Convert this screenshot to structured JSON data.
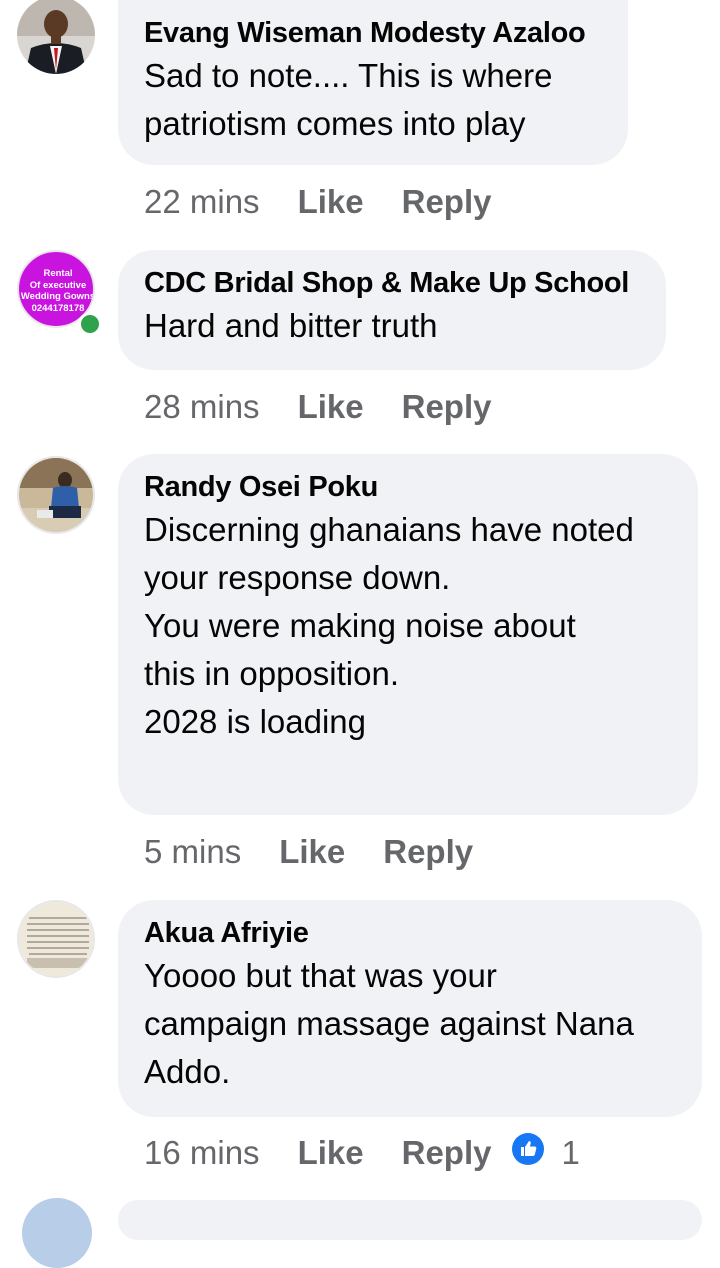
{
  "comments": [
    {
      "author": "Evang Wiseman Modesty Azaloo",
      "lines": [
        "Sad to note.... This is where",
        "patriotism comes into play"
      ],
      "time": "22 mins",
      "like_label": "Like",
      "reply_label": "Reply"
    },
    {
      "author": "CDC Bridal Shop & Make Up School",
      "avatar_text": [
        "Rental",
        "Of executive",
        "Wedding Gowns",
        "0244178178"
      ],
      "lines": [
        "Hard and bitter truth"
      ],
      "time": "28 mins",
      "like_label": "Like",
      "reply_label": "Reply"
    },
    {
      "author": "Randy Osei Poku",
      "lines": [
        "Discerning ghanaians have noted",
        "your response down.",
        "You were making noise about",
        "this in opposition.",
        "",
        "2028 is loading"
      ],
      "time": "5 mins",
      "like_label": "Like",
      "reply_label": "Reply"
    },
    {
      "author": "Akua Afriyie",
      "lines": [
        "Yoooo but that was your",
        "campaign massage against Nana",
        "Addo."
      ],
      "time": "16 mins",
      "like_label": "Like",
      "reply_label": "Reply",
      "reaction": {
        "icon": "like-reaction-icon",
        "count": "1"
      }
    }
  ],
  "colors": {
    "bubble": "#f0f2f5",
    "meta_text": "#65676b",
    "like_blue": "#1877f2",
    "online_green": "#31a24c",
    "cdc_avatar": "#c914e0"
  }
}
